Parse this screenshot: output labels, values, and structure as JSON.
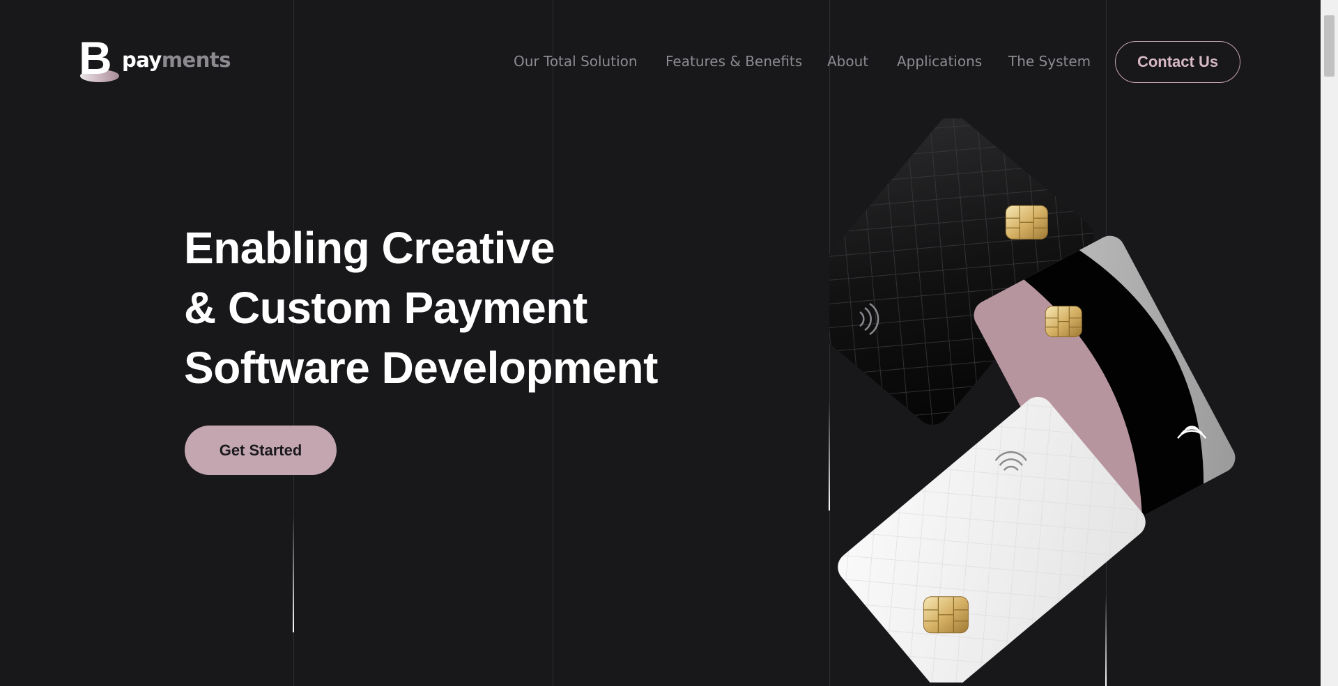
{
  "brand": {
    "mark": "B",
    "name_part1": "pay",
    "name_part2": "ments"
  },
  "nav": {
    "items": [
      {
        "id": "our-total-solution",
        "label": "Our Total Solution"
      },
      {
        "id": "features-benefits",
        "label": "Features & Benefits"
      },
      {
        "id": "about",
        "label": "About"
      },
      {
        "id": "applications",
        "label": "Applications"
      },
      {
        "id": "the-system",
        "label": "The System"
      }
    ],
    "contact_label": "Contact Us"
  },
  "hero": {
    "title_lines": [
      "Enabling Creative",
      "& Custom Payment",
      "Software Development"
    ],
    "cta_label": "Get Started"
  },
  "illustration": {
    "icons": [
      "chip-icon",
      "contactless-icon"
    ],
    "cards": [
      "black-card",
      "pink-black-grey-card",
      "white-card"
    ]
  },
  "colors": {
    "background": "#18171a",
    "accent_pink": "#c4a6b1",
    "nav_text": "#8d8c91",
    "white": "#ffffff"
  }
}
